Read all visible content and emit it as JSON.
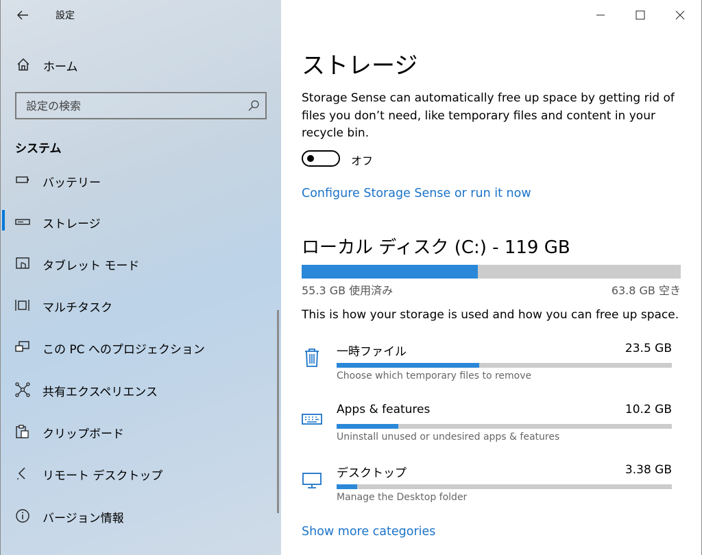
{
  "app": {
    "title": "設定"
  },
  "sidebar": {
    "home_label": "ホーム",
    "search_placeholder": "設定の検索",
    "section": "システム",
    "items": [
      {
        "label": "バッテリー",
        "icon": "battery-icon"
      },
      {
        "label": "ストレージ",
        "icon": "storage-icon",
        "active": true
      },
      {
        "label": "タブレット モード",
        "icon": "tablet-mode-icon"
      },
      {
        "label": "マルチタスク",
        "icon": "multitasking-icon"
      },
      {
        "label": "この PC へのプロジェクション",
        "icon": "projection-icon"
      },
      {
        "label": "共有エクスペリエンス",
        "icon": "shared-experiences-icon"
      },
      {
        "label": "クリップボード",
        "icon": "clipboard-icon"
      },
      {
        "label": "リモート デスクトップ",
        "icon": "remote-desktop-icon"
      },
      {
        "label": "バージョン情報",
        "icon": "info-icon"
      }
    ]
  },
  "main": {
    "title": "ストレージ",
    "description": "Storage Sense can automatically free up space by getting rid of files you don’t need, like temporary files and content in your recycle bin.",
    "toggle_label": "オフ",
    "toggle_on": false,
    "configure_link": "Configure Storage Sense or run it now",
    "disk": {
      "title": "ローカル ディスク (C:) - 119 GB",
      "used_label": "55.3 GB 使用済み",
      "free_label": "63.8 GB 空き",
      "used_fraction": 0.465
    },
    "usage_note": "This is how your storage is used and how you can free up space.",
    "categories": [
      {
        "name": "一時ファイル",
        "size": "23.5 GB",
        "sub": "Choose which temporary files to remove",
        "fraction": 0.425,
        "icon": "trash-icon"
      },
      {
        "name": "Apps & features",
        "size": "10.2 GB",
        "sub": "Uninstall unused or undesired apps & features",
        "fraction": 0.185,
        "icon": "keyboard-icon"
      },
      {
        "name": "デスクトップ",
        "size": "3.38 GB",
        "sub": "Manage the Desktop folder",
        "fraction": 0.061,
        "icon": "monitor-icon"
      }
    ],
    "more_link": "Show more categories"
  },
  "colors": {
    "accent": "#0078d7",
    "link": "#1a73c9",
    "bar_fill": "#2b88d8",
    "bar_track": "#cccccc"
  }
}
